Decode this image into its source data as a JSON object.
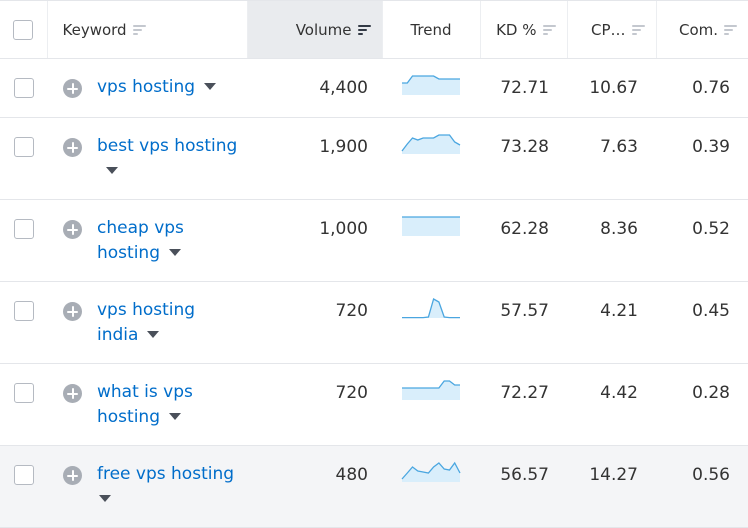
{
  "header": {
    "keyword": "Keyword",
    "volume": "Volume",
    "trend": "Trend",
    "kd": "KD %",
    "cpc": "CP…",
    "com": "Com."
  },
  "colors": {
    "link": "#006dca",
    "sparkline": "#4aa6e0",
    "sparkline_fill": "#d9eefb"
  },
  "rows": [
    {
      "keyword": "vps hosting",
      "volume": "4,400",
      "kd": "72.71",
      "cpc": "10.67",
      "com": "0.76",
      "trend": [
        0.6,
        0.6,
        0.95,
        0.95,
        0.95,
        0.95,
        0.95,
        0.8,
        0.8,
        0.8,
        0.8,
        0.8
      ]
    },
    {
      "keyword": "best vps hosting",
      "volume": "1,900",
      "kd": "73.28",
      "cpc": "7.63",
      "com": "0.39",
      "trend": [
        0.15,
        0.5,
        0.8,
        0.7,
        0.8,
        0.8,
        0.8,
        0.95,
        0.95,
        0.95,
        0.6,
        0.45
      ]
    },
    {
      "keyword": "cheap vps hosting",
      "volume": "1,000",
      "kd": "62.28",
      "cpc": "8.36",
      "com": "0.52",
      "trend": [
        0.95,
        0.95,
        0.95,
        0.95,
        0.95,
        0.95,
        0.95,
        0.95,
        0.95,
        0.95,
        0.95,
        0.95
      ]
    },
    {
      "keyword": "vps hosting india",
      "volume": "720",
      "kd": "57.57",
      "cpc": "4.21",
      "com": "0.45",
      "trend": [
        0.02,
        0.02,
        0.02,
        0.02,
        0.02,
        0.05,
        0.95,
        0.8,
        0.05,
        0.02,
        0.02,
        0.02
      ]
    },
    {
      "keyword": "what is vps hosting",
      "volume": "720",
      "kd": "72.27",
      "cpc": "4.42",
      "com": "0.28",
      "trend": [
        0.6,
        0.6,
        0.6,
        0.6,
        0.6,
        0.6,
        0.6,
        0.6,
        0.95,
        0.95,
        0.75,
        0.75
      ]
    },
    {
      "keyword": "free vps hosting",
      "volume": "480",
      "kd": "56.57",
      "cpc": "14.27",
      "com": "0.56",
      "trend": [
        0.15,
        0.45,
        0.75,
        0.55,
        0.5,
        0.45,
        0.75,
        0.95,
        0.65,
        0.6,
        0.95,
        0.45
      ]
    }
  ]
}
